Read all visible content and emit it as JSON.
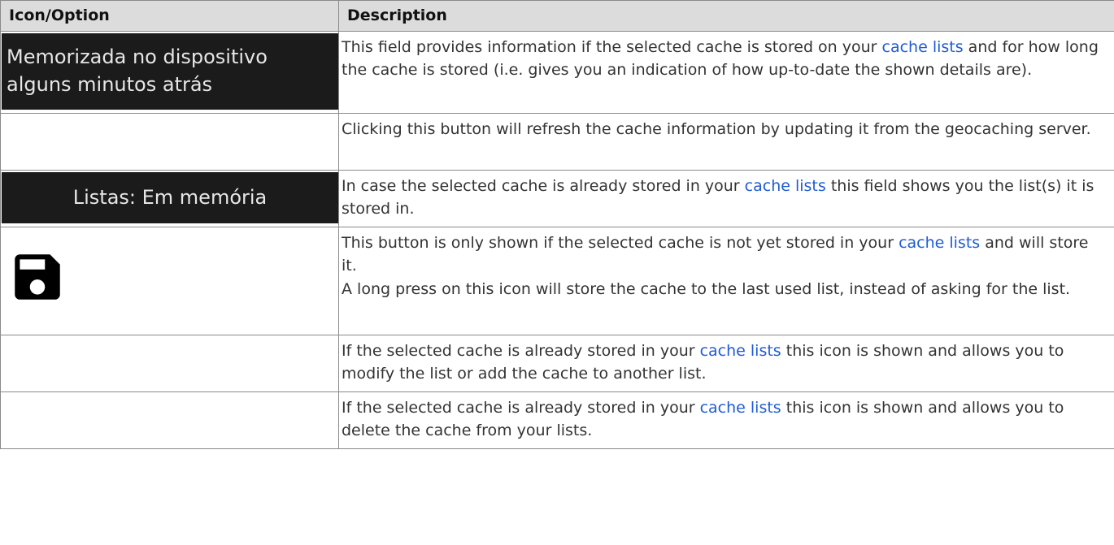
{
  "table": {
    "headers": [
      "Icon/Option",
      "Description"
    ],
    "rows": [
      {
        "icon_text_line1": "Memorizada no dispositivo",
        "icon_text_line2": "alguns minutos atrás",
        "desc_before_link": "This field provides information if the selected cache is stored on your ",
        "link": "cache lists",
        "desc_after_link": " and for how long the cache is stored (i.e. gives you an indication of how up-to-date the shown details are)."
      },
      {
        "desc": "Clicking this button will refresh the cache information by updating it from the geocaching server."
      },
      {
        "icon_text": "Listas: Em memória",
        "desc_before_link": "In case the selected cache is already stored in your ",
        "link": "cache lists",
        "desc_after_link": " this field shows you the list(s) it is stored in."
      },
      {
        "icon": "save-icon",
        "desc_before_link": "This button is only shown if the selected cache is not yet stored in your ",
        "link": "cache lists",
        "desc_after_link": " and will store it.",
        "desc_line2": "A long press on this icon will store the cache to the last used list, instead of asking for the list."
      },
      {
        "desc_before_link": "If the selected cache is already stored in your ",
        "link": "cache lists",
        "desc_after_link": " this icon is shown and allows you to modify the list or add the cache to another list."
      },
      {
        "desc_before_link": "If the selected cache is already stored in your ",
        "link": "cache lists",
        "desc_after_link": " this icon is shown and allows you to delete the cache from your lists."
      }
    ]
  },
  "colors": {
    "header_bg": "#dcdcdc",
    "link": "#1f5bd6",
    "chip_bg": "#1b1b1b",
    "border": "#8a8a8a"
  }
}
